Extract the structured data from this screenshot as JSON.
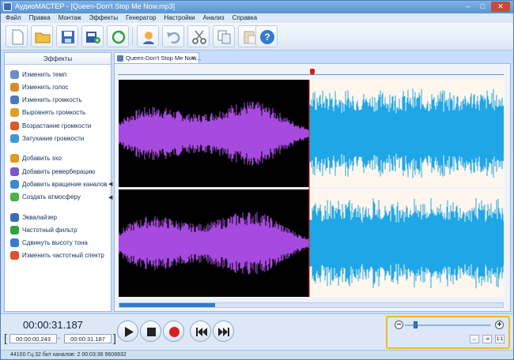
{
  "window": {
    "title": "АудиоМАСТЕР - [Queen-Don't Stop Me Now.mp3]",
    "buttons": {
      "minimize": "–",
      "maximize": "□",
      "close": "✕"
    }
  },
  "menu": [
    "Файл",
    "Правка",
    "Монтаж",
    "Эффекты",
    "Генератор",
    "Настройки",
    "Анализ",
    "Справка"
  ],
  "toolbar": {
    "icons": [
      "new-file-icon",
      "open-folder-icon",
      "save-icon",
      "save-as-icon",
      "refresh-icon",
      "voice-icon",
      "undo-icon",
      "cut-icon",
      "copy-icon",
      "paste-icon",
      "help-icon"
    ]
  },
  "sidebar": {
    "title": "Эффекты",
    "groups": [
      [
        {
          "label": "Изменить темп",
          "icon": "clock-icon",
          "color": "#6a8cc8"
        },
        {
          "label": "Изменить голос",
          "icon": "person-icon",
          "color": "#d98a2a"
        },
        {
          "label": "Изменить громкость",
          "icon": "speaker-icon",
          "color": "#4a78c0"
        },
        {
          "label": "Выровнять громкость",
          "icon": "level-icon",
          "color": "#e0a020"
        },
        {
          "label": "Возрастание громкости",
          "icon": "volume-up-icon",
          "color": "#d85a2a"
        },
        {
          "label": "Затухание громкости",
          "icon": "volume-down-icon",
          "color": "#3a9ad8"
        }
      ],
      [
        {
          "label": "Добавить эхо",
          "icon": "echo-icon",
          "color": "#e09a20"
        },
        {
          "label": "Добавить реверберацию",
          "icon": "reverb-icon",
          "color": "#7a5ac8"
        },
        {
          "label": "Добавить вращение каналов",
          "icon": "rotate-channels-icon",
          "color": "#3a8ad0"
        },
        {
          "label": "Создать атмосферу",
          "icon": "atmosphere-icon",
          "color": "#4ab04a"
        }
      ],
      [
        {
          "label": "Эквалайзер",
          "icon": "equalizer-icon",
          "color": "#3a6ac0"
        },
        {
          "label": "Частотный фильтр",
          "icon": "filter-icon",
          "color": "#30a040"
        },
        {
          "label": "Сдвинуть высоту тона",
          "icon": "pitch-icon",
          "color": "#3a7ad0"
        },
        {
          "label": "Изменить частотный спектр",
          "icon": "spectrum-icon",
          "color": "#e05030"
        }
      ]
    ],
    "chevron": "◀"
  },
  "tab": {
    "label": "Queen-Don't Stop Me Now..."
  },
  "editor": {
    "selection_fraction": 0.5,
    "scroll_fraction": 0.25,
    "colors": {
      "selected": "#a74be0",
      "unselected": "#1ea6e6",
      "selected_bg": "#000000",
      "unselected_bg": "#fff7ee"
    }
  },
  "bottom": {
    "current_time": "00:00:31.187",
    "start_time": "00:00:00.243",
    "end_time": "00:00:31.187",
    "dash": "-",
    "play_buttons": [
      "play-icon",
      "stop-icon",
      "record-icon",
      "prev-icon",
      "next-icon"
    ],
    "zoom": {
      "minus": "−",
      "plus": "+",
      "level": 0.1,
      "fit": "↔",
      "center": "⇥",
      "ratio": "1:1"
    }
  },
  "status": "44100 Гц  32 бит  каналов: 2   00:03:38 9608832"
}
